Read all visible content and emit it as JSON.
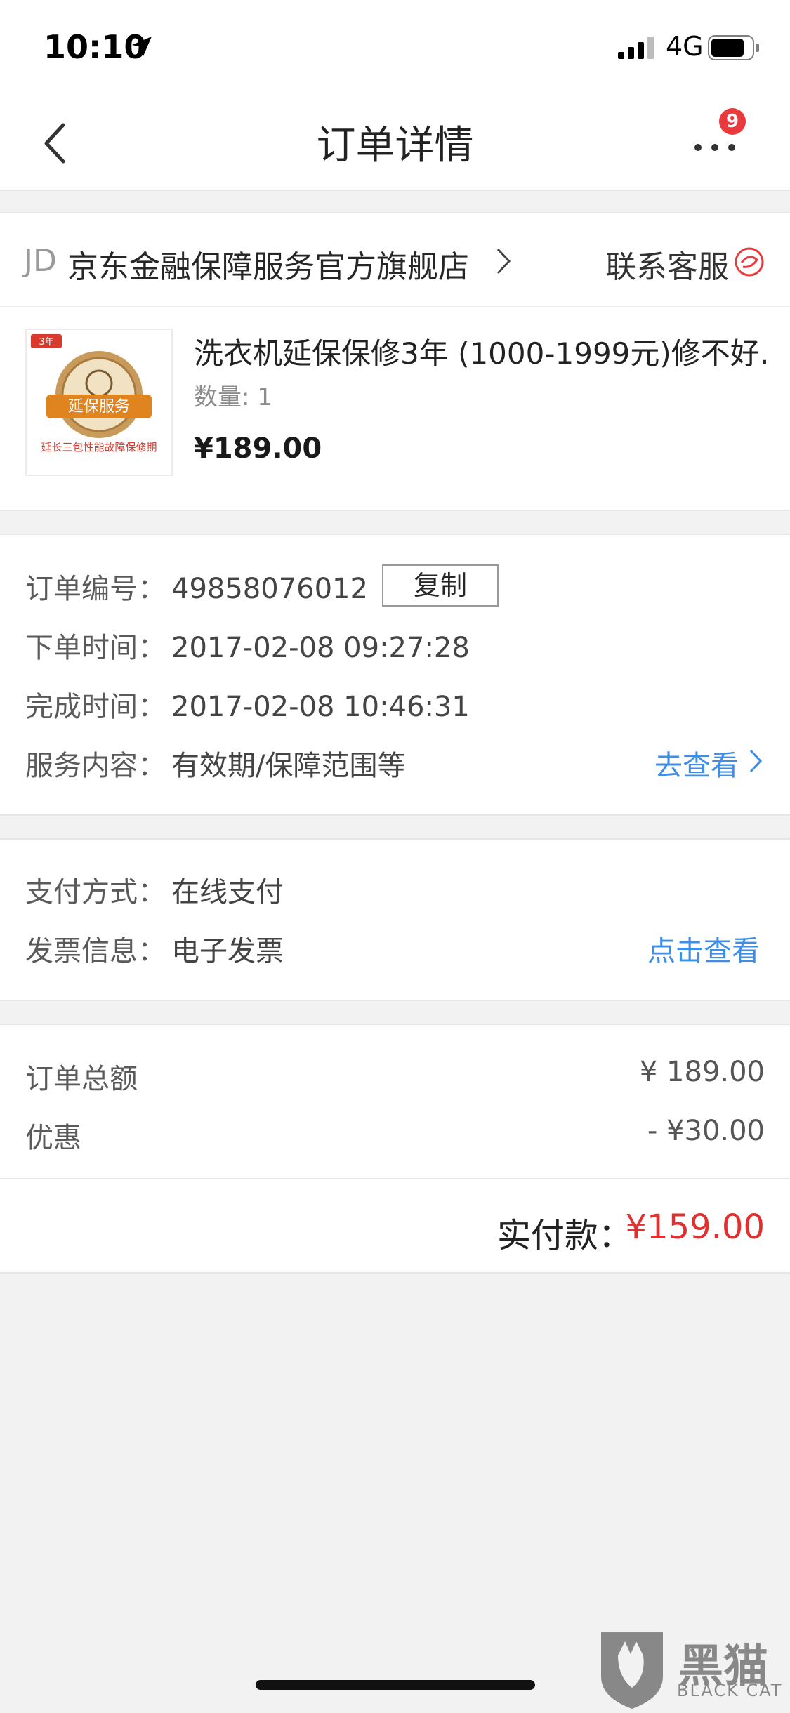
{
  "status_bar": {
    "time": "10:10",
    "network": "4G"
  },
  "nav": {
    "title": "订单详情",
    "badge_count": "9"
  },
  "store": {
    "logo_text": "JD",
    "name": "京东金融保障服务官方旗舰店",
    "contact_label": "联系客服"
  },
  "product": {
    "thumb_tag": "3年",
    "thumb_badge": "延保服务",
    "thumb_caption": "延长三包性能故障保修期",
    "title": "洗衣机延保保修3年 (1000-1999元)修不好…",
    "quantity_label": "数量: 1",
    "price": "¥189.00"
  },
  "order_info": {
    "order_no_label": "订单编号：",
    "order_no": "49858076012",
    "copy_label": "复制",
    "order_time_label": "下单时间：",
    "order_time": "2017-02-08 09:27:28",
    "complete_time_label": "完成时间：",
    "complete_time": "2017-02-08 10:46:31",
    "service_label": "服务内容：",
    "service_value": "有效期/保障范围等",
    "service_link": "去查看"
  },
  "payment": {
    "method_label": "支付方式：",
    "method_value": "在线支付",
    "invoice_label": "发票信息：",
    "invoice_value": "电子发票",
    "invoice_link": "点击查看"
  },
  "totals": {
    "total_label": "订单总额",
    "total_value": "¥ 189.00",
    "discount_label": "优惠",
    "discount_value": "- ¥30.00",
    "paid_label": "实付款：",
    "paid_value": "¥159.00"
  },
  "watermark": {
    "main": "黑猫",
    "sub": "BLACK CAT"
  },
  "colors": {
    "accent_red": "#e3302e",
    "link_blue": "#3e8de6",
    "badge_red": "#e93b3d"
  }
}
